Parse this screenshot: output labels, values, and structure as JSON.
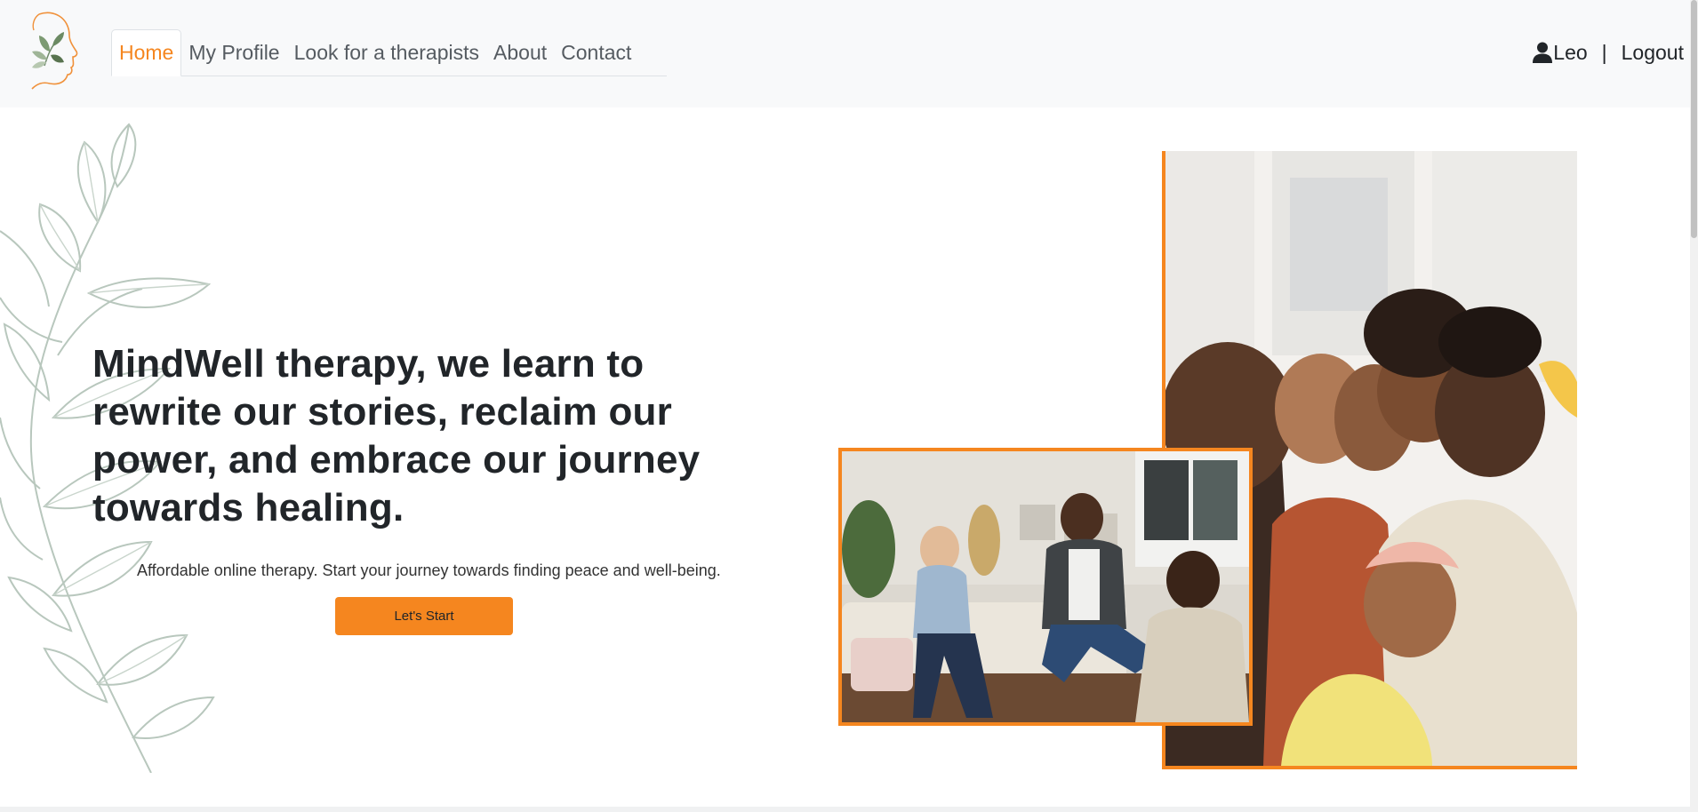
{
  "brand": {
    "logo_icon": "leaf-face-logo-icon",
    "accent_color": "#f5861f"
  },
  "nav": {
    "items": [
      {
        "label": "Home",
        "active": true
      },
      {
        "label": "My Profile"
      },
      {
        "label": "Look for a therapists"
      },
      {
        "label": "About"
      },
      {
        "label": "Contact"
      }
    ]
  },
  "user": {
    "icon": "user-icon",
    "name": "Leo",
    "separator": "|",
    "logout_label": "Logout"
  },
  "hero": {
    "headline": "MindWell therapy, we learn to rewrite our stories, reclaim our power, and embrace our journey towards healing.",
    "subtext": "Affordable online therapy. Start your journey towards finding peace and well-being.",
    "cta_label": "Let's Start",
    "images": [
      "family-group-hug-photo",
      "therapy-session-photo"
    ]
  }
}
